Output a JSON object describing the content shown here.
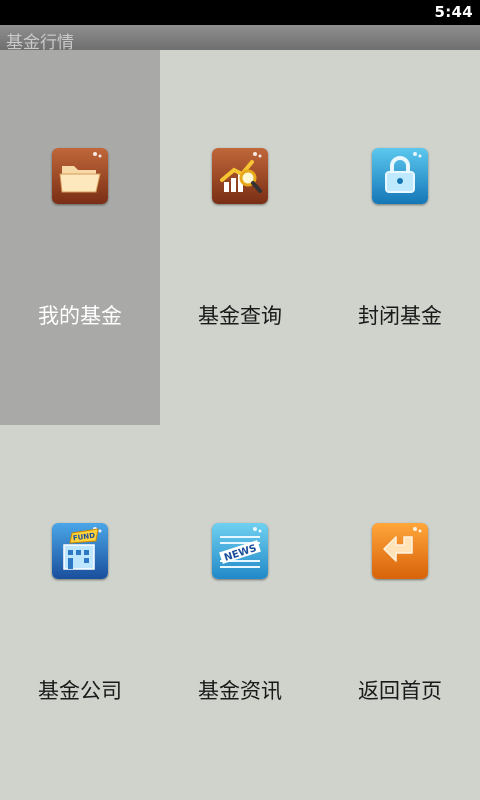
{
  "status_bar": {
    "time": "5:44"
  },
  "title_bar": {
    "title": "基金行情"
  },
  "menu": {
    "items": [
      {
        "label": "我的基金",
        "icon": "folder-icon",
        "selected": true
      },
      {
        "label": "基金查询",
        "icon": "chart-search-icon",
        "selected": false
      },
      {
        "label": "封闭基金",
        "icon": "lock-icon",
        "selected": false
      },
      {
        "label": "基金公司",
        "icon": "fund-building-icon",
        "selected": false
      },
      {
        "label": "基金资讯",
        "icon": "news-icon",
        "selected": false
      },
      {
        "label": "返回首页",
        "icon": "back-arrow-icon",
        "selected": false
      }
    ]
  },
  "colors": {
    "background": "#cfd3cc",
    "selected_cell": "#a9aaa8",
    "title_bar": "#7f7f7f"
  }
}
